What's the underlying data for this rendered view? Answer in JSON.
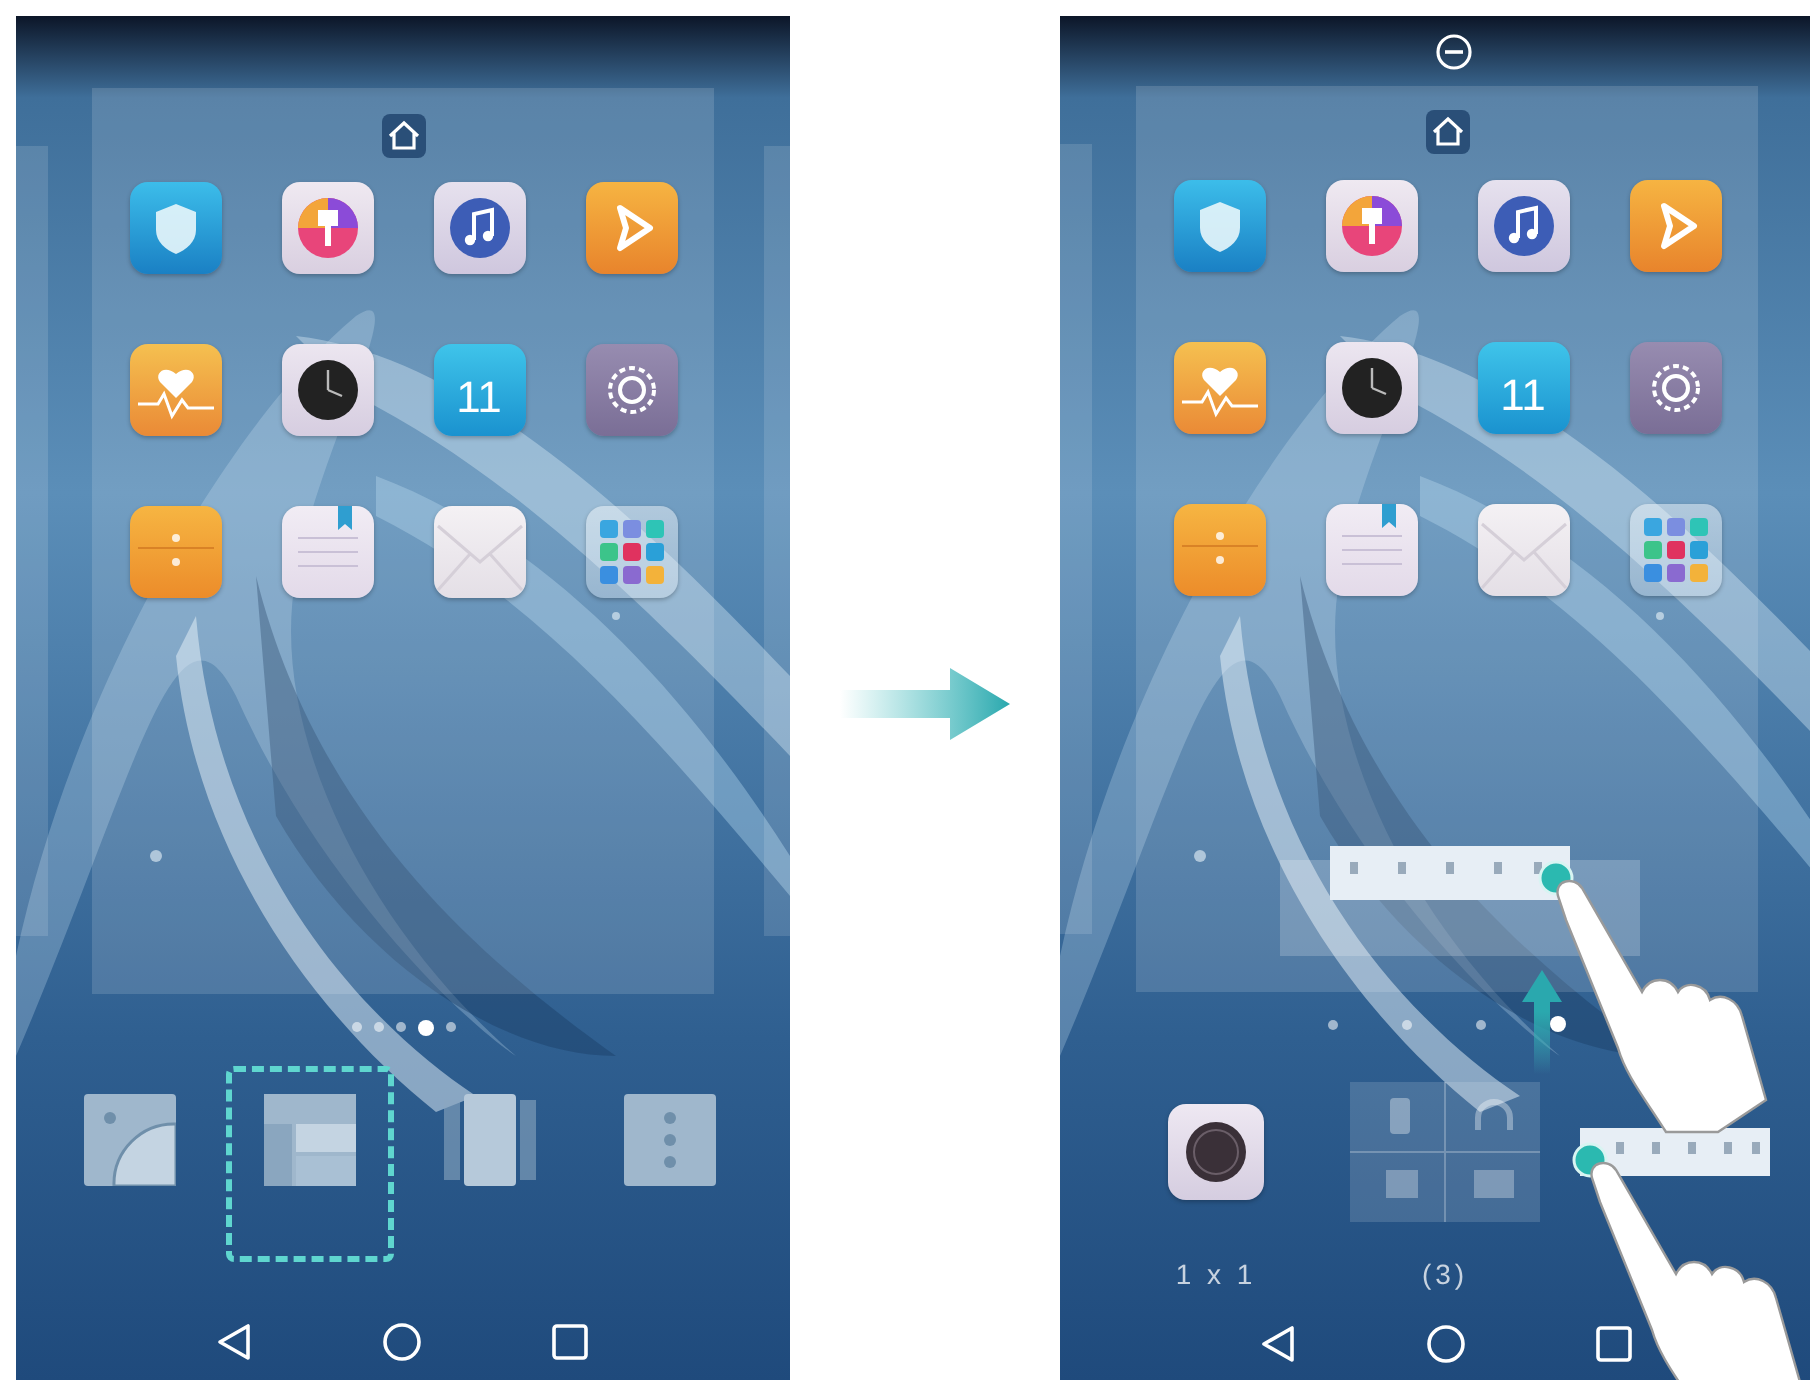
{
  "screens": [
    {
      "remove_target": false,
      "drag_gesture": false,
      "neighbor_pages": {
        "left": true,
        "right": true
      },
      "apps": [
        {
          "kind": "shield"
        },
        {
          "kind": "themes"
        },
        {
          "kind": "music"
        },
        {
          "kind": "videos"
        },
        {
          "kind": "health"
        },
        {
          "kind": "clock"
        },
        {
          "kind": "calendar",
          "date": "11"
        },
        {
          "kind": "settings"
        },
        {
          "kind": "notes"
        },
        {
          "kind": "notepad"
        },
        {
          "kind": "email"
        },
        {
          "kind": "folder"
        }
      ],
      "page_dots": [
        {
          "selected": false
        },
        {
          "selected": false
        },
        {
          "selected": false
        },
        {
          "selected": true
        },
        {
          "selected": false
        }
      ],
      "tray": {
        "kind": "options",
        "items": [
          {
            "kind": "wallpaper",
            "selected": false
          },
          {
            "kind": "widgets",
            "selected": true
          },
          {
            "kind": "transitions",
            "selected": false
          },
          {
            "kind": "settings",
            "selected": false
          }
        ]
      }
    },
    {
      "remove_target": true,
      "drag_gesture": true,
      "neighbor_pages": {
        "left": true,
        "right": false
      },
      "apps": [
        {
          "kind": "shield"
        },
        {
          "kind": "themes"
        },
        {
          "kind": "music"
        },
        {
          "kind": "videos"
        },
        {
          "kind": "health"
        },
        {
          "kind": "clock"
        },
        {
          "kind": "calendar",
          "date": "11"
        },
        {
          "kind": "settings"
        },
        {
          "kind": "notes"
        },
        {
          "kind": "notepad"
        },
        {
          "kind": "email"
        },
        {
          "kind": "folder"
        }
      ],
      "page_dots": [
        {
          "selected": false
        },
        {
          "selected": false
        },
        {
          "selected": false
        },
        {
          "selected": true
        }
      ],
      "tray": {
        "kind": "widgets",
        "items": [
          {
            "kind": "app",
            "caption": "1 x 1"
          },
          {
            "kind": "stack",
            "caption": "(3)"
          },
          {
            "kind": "toggles"
          }
        ]
      }
    }
  ]
}
